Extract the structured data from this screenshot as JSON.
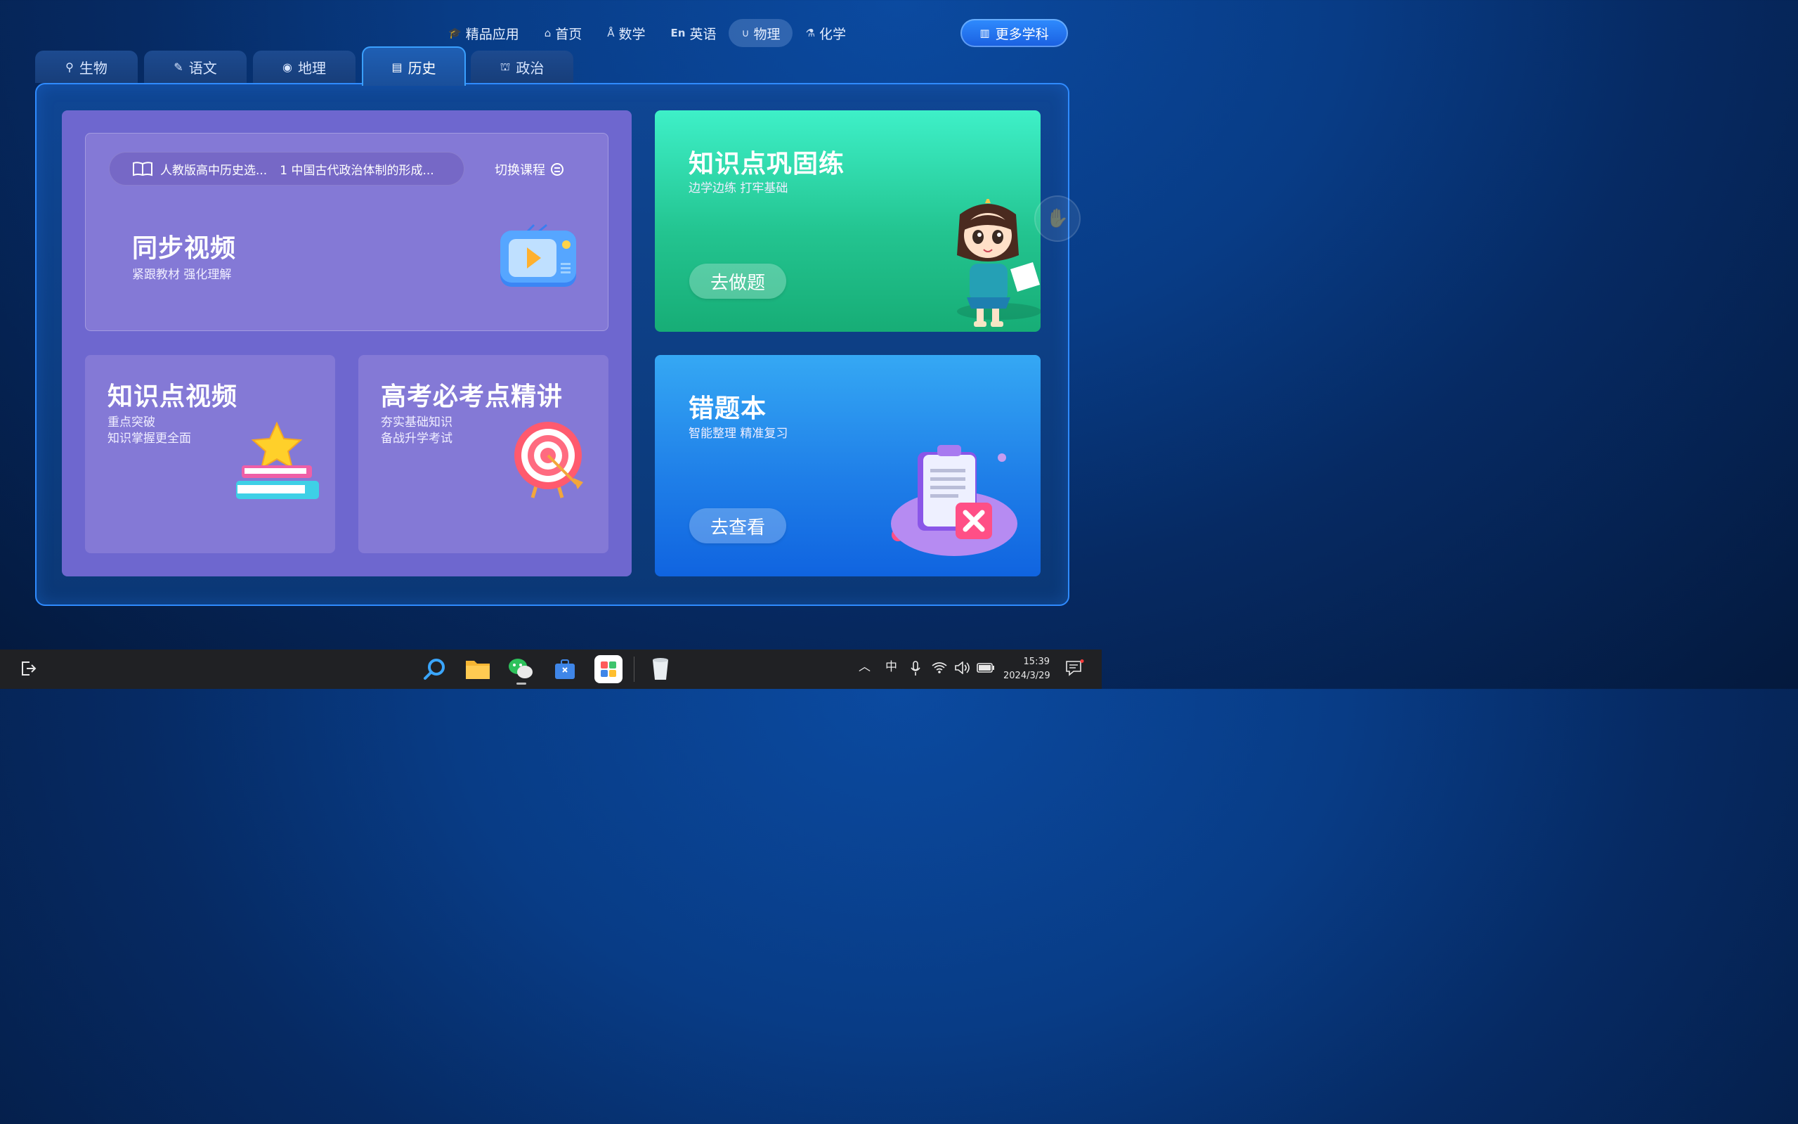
{
  "top_nav": {
    "items": [
      {
        "label": "精品应用",
        "icon": "graduation-cap-icon"
      },
      {
        "label": "首页",
        "icon": "home-icon"
      },
      {
        "label": "数学",
        "icon": "math-icon"
      },
      {
        "label": "英语",
        "icon": "english-icon"
      },
      {
        "label": "物理",
        "icon": "magnet-icon"
      },
      {
        "label": "化学",
        "icon": "flask-icon"
      }
    ],
    "active": "物理",
    "more_label": "更多学科"
  },
  "tabs": [
    {
      "label": "生物",
      "icon": "microscope-icon"
    },
    {
      "label": "语文",
      "icon": "pen-icon"
    },
    {
      "label": "地理",
      "icon": "globe-icon"
    },
    {
      "label": "历史",
      "icon": "scroll-icon"
    },
    {
      "label": "政治",
      "icon": "podium-icon"
    }
  ],
  "active_tab": "历史",
  "sync_video": {
    "course_book": "人教版高中历史选...",
    "course_chapter": "1 中国古代政治体制的形成...",
    "switch_label": "切换课程",
    "title": "同步视频",
    "subtitle": "紧跟教材 强化理解"
  },
  "knowledge_video": {
    "title": "知识点视频",
    "line1": "重点突破",
    "line2": "知识掌握更全面"
  },
  "gaokao": {
    "title": "高考必考点精讲",
    "line1": "夯实基础知识",
    "line2": "备战升学考试"
  },
  "practice": {
    "title": "知识点巩固练",
    "subtitle": "边学边练 打牢基础",
    "button": "去做题"
  },
  "mistakes": {
    "title": "错题本",
    "subtitle": "智能整理 精准复习",
    "button": "去查看"
  },
  "taskbar": {
    "ime": "中",
    "time": "15:39",
    "date": "2024/3/29"
  }
}
